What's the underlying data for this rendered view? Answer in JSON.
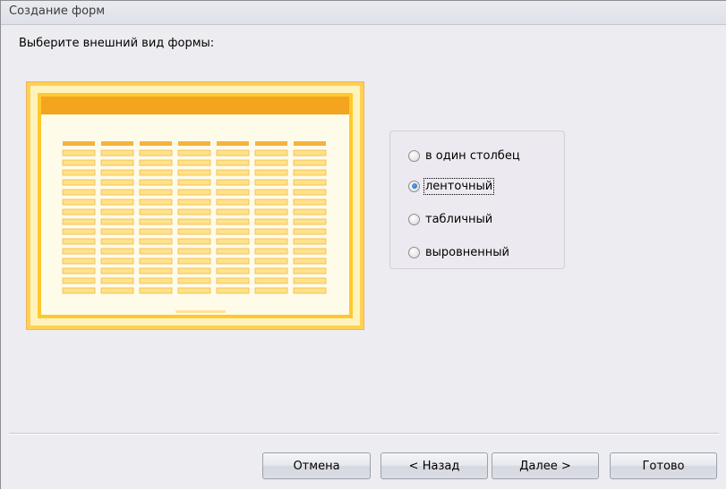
{
  "window": {
    "title": "Создание форм"
  },
  "prompt": "Выберите внешний вид формы:",
  "layout_options": [
    {
      "label": "в один столбец",
      "selected": false
    },
    {
      "label": "ленточный",
      "selected": true
    },
    {
      "label": "табличный",
      "selected": false
    },
    {
      "label": "выровненный",
      "selected": false
    }
  ],
  "buttons": {
    "cancel": "Отмена",
    "back": "< Назад",
    "next": "Далее >",
    "finish": "Готово"
  },
  "colors": {
    "preview_accent": "#f3a51f",
    "preview_field": "#ffe28a"
  }
}
